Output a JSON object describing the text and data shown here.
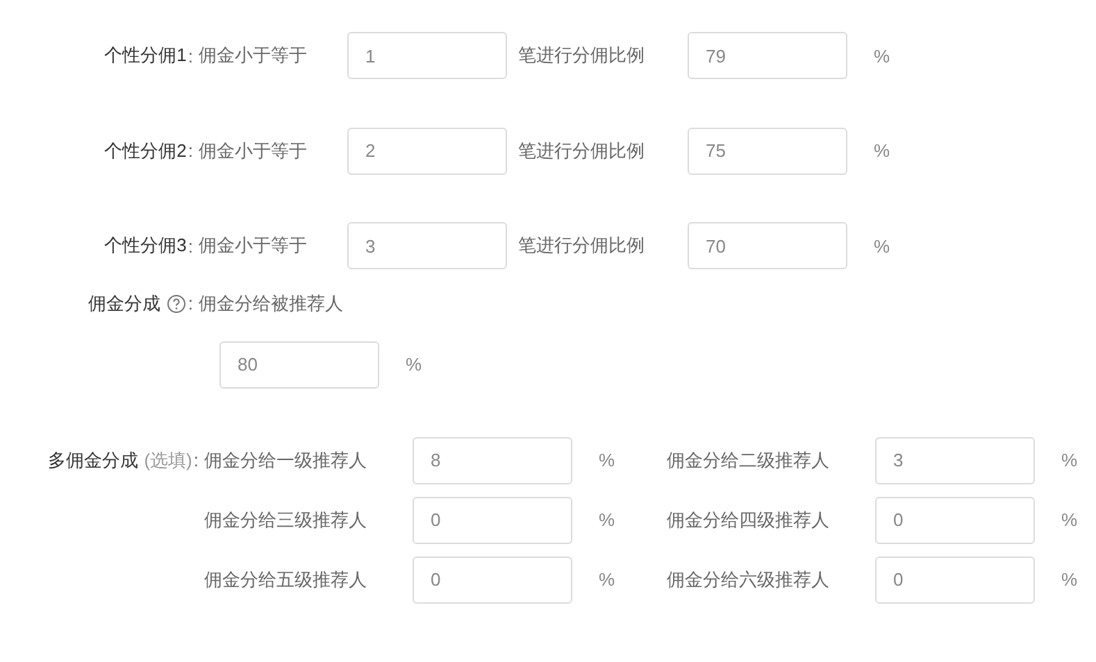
{
  "tiers": [
    {
      "label": "个性分佣1",
      "colon": ":",
      "prefix": "佣金小于等于",
      "count": "1",
      "middle": "笔进行分佣比例",
      "rate": "79",
      "unit": "%"
    },
    {
      "label": "个性分佣2",
      "colon": ":",
      "prefix": "佣金小于等于",
      "count": "2",
      "middle": "笔进行分佣比例",
      "rate": "75",
      "unit": "%"
    },
    {
      "label": "个性分佣3",
      "colon": ":",
      "prefix": "佣金小于等于",
      "count": "3",
      "middle": "笔进行分佣比例",
      "rate": "70",
      "unit": "%"
    }
  ],
  "split": {
    "label": "佣金分成",
    "colon": ":",
    "text": "佣金分给被推荐人",
    "value": "80",
    "unit": "%"
  },
  "multi": {
    "label": "多佣金分成",
    "hint": "(选填)",
    "colon": ":",
    "levels": [
      {
        "label": "佣金分给一级推荐人",
        "value": "8",
        "unit": "%"
      },
      {
        "label": "佣金分给二级推荐人",
        "value": "3",
        "unit": "%"
      },
      {
        "label": "佣金分给三级推荐人",
        "value": "0",
        "unit": "%"
      },
      {
        "label": "佣金分给四级推荐人",
        "value": "0",
        "unit": "%"
      },
      {
        "label": "佣金分给五级推荐人",
        "value": "0",
        "unit": "%"
      },
      {
        "label": "佣金分给六级推荐人",
        "value": "0",
        "unit": "%"
      }
    ]
  }
}
